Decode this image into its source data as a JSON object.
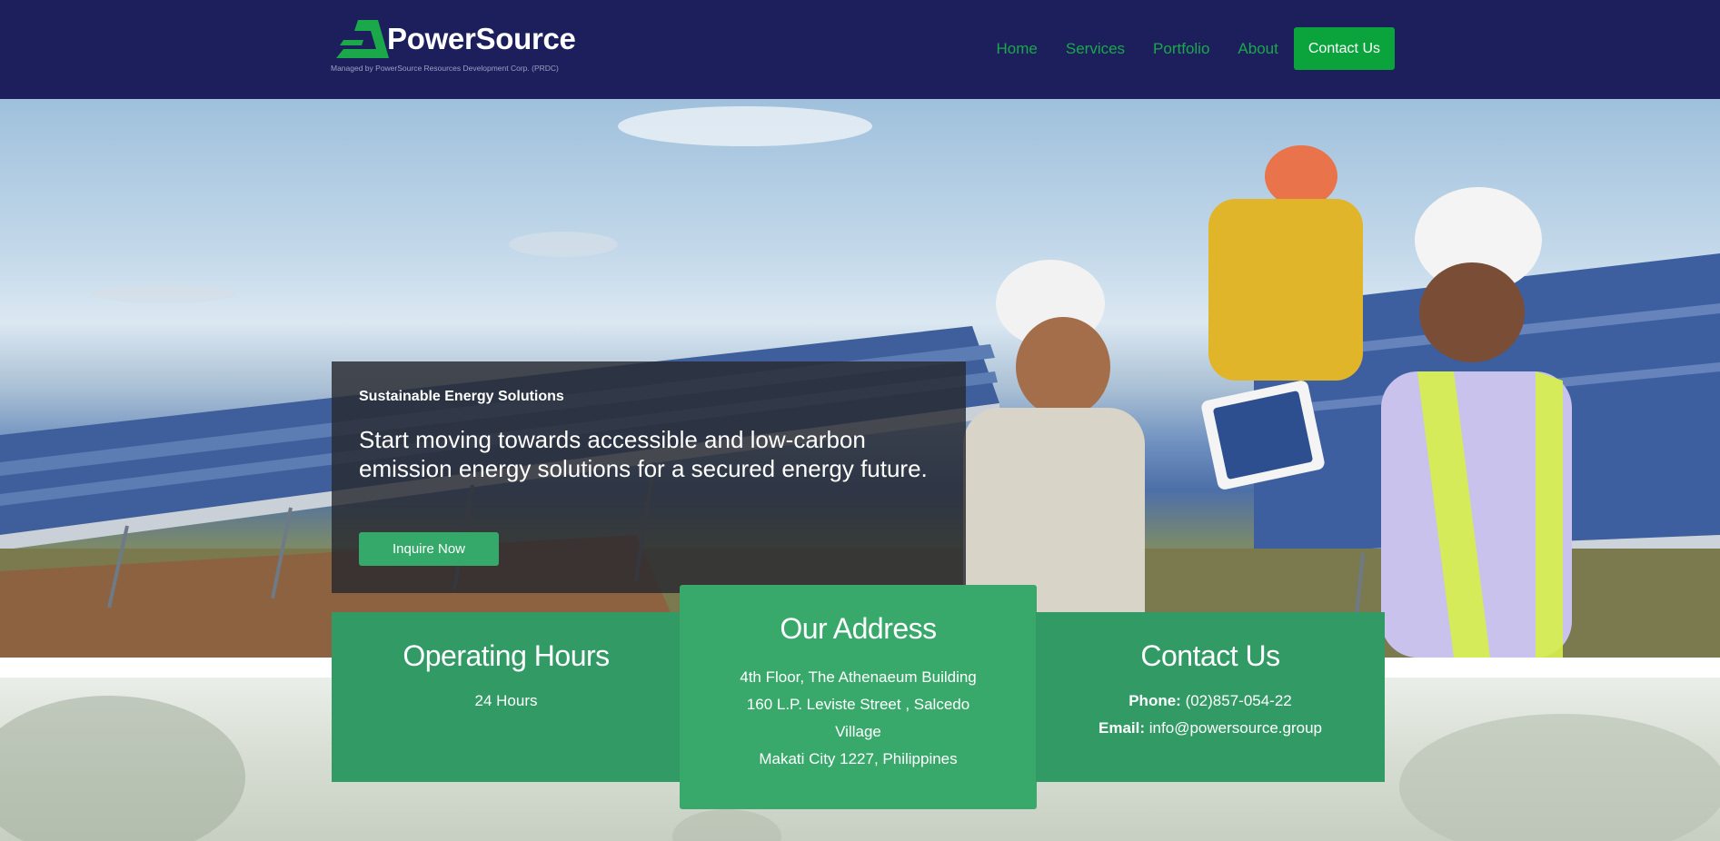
{
  "header": {
    "brand": "PowerSource",
    "tagline": "Managed by PowerSource Resources Development Corp. (PRDC)",
    "nav": [
      {
        "label": "Home"
      },
      {
        "label": "Services"
      },
      {
        "label": "Portfolio"
      },
      {
        "label": "About"
      }
    ],
    "cta_label": "Contact Us"
  },
  "hero": {
    "kicker": "Sustainable Energy Solutions",
    "headline": "Start moving towards accessible and low-carbon emission energy solutions for a secured energy future.",
    "button_label": "Inquire Now",
    "image": "workers-on-solar-panels"
  },
  "cards": {
    "hours": {
      "title": "Operating Hours",
      "value": "24 Hours"
    },
    "address": {
      "title": "Our Address",
      "lines": [
        "4th Floor, The Athenaeum Building",
        "160 L.P. Leviste Street , Salcedo Village",
        "Makati City 1227, Philippines"
      ]
    },
    "contact": {
      "title": "Contact Us",
      "phone_label": "Phone:",
      "phone": "(02)857-054-22",
      "email_label": "Email:",
      "email": "info@powersource.group"
    }
  },
  "colors": {
    "header_bg": "#1d1f5c",
    "brand_green": "#0aa33c",
    "card_green": "#329b65"
  }
}
